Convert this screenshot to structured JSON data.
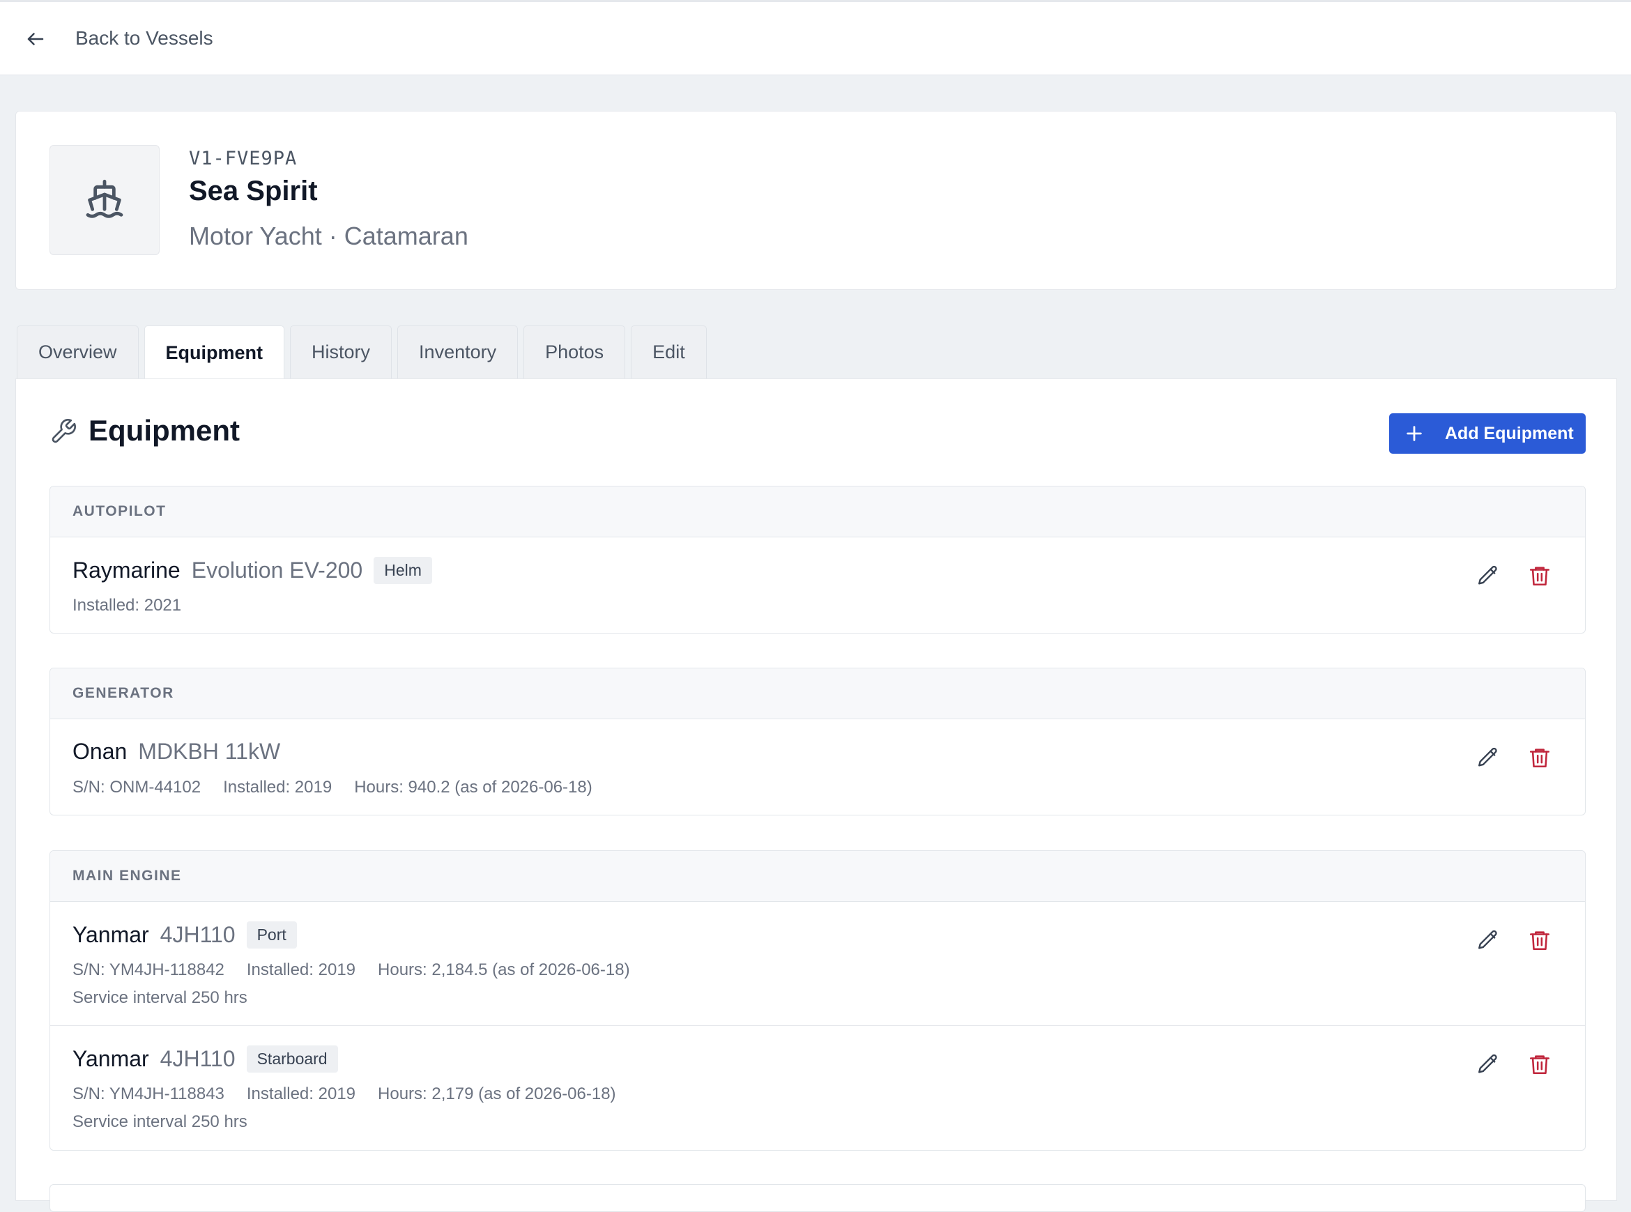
{
  "nav": {
    "back_label": "Back to Vessels"
  },
  "vessel": {
    "id": "V1-FVE9PA",
    "name": "Sea Spirit",
    "type_line": "Motor Yacht · Catamaran"
  },
  "tabs": [
    {
      "label": "Overview"
    },
    {
      "label": "Equipment"
    },
    {
      "label": "History"
    },
    {
      "label": "Inventory"
    },
    {
      "label": "Photos"
    },
    {
      "label": "Edit"
    }
  ],
  "active_tab": "Equipment",
  "section": {
    "title": "Equipment",
    "add_button": "Add Equipment"
  },
  "groups": [
    {
      "name": "AUTOPILOT",
      "items": [
        {
          "make": "Raymarine",
          "model": "Evolution EV-200",
          "tag": "Helm",
          "meta": [
            "Installed: 2021"
          ],
          "extra": ""
        }
      ]
    },
    {
      "name": "GENERATOR",
      "items": [
        {
          "make": "Onan",
          "model": "MDKBH 11kW",
          "tag": "",
          "meta": [
            "S/N: ONM-44102",
            "Installed: 2019",
            "Hours: 940.2 (as of 2026-06-18)"
          ],
          "extra": ""
        }
      ]
    },
    {
      "name": "MAIN ENGINE",
      "items": [
        {
          "make": "Yanmar",
          "model": "4JH110",
          "tag": "Port",
          "meta": [
            "S/N: YM4JH-118842",
            "Installed: 2019",
            "Hours: 2,184.5 (as of 2026-06-18)"
          ],
          "extra": "Service interval 250 hrs"
        },
        {
          "make": "Yanmar",
          "model": "4JH110",
          "tag": "Starboard",
          "meta": [
            "S/N: YM4JH-118843",
            "Installed: 2019",
            "Hours: 2,179 (as of 2026-06-18)"
          ],
          "extra": "Service interval 250 hrs"
        }
      ]
    }
  ],
  "colors": {
    "accent": "#2b5bd7",
    "danger": "#c0263c",
    "background": "#eef1f4"
  }
}
